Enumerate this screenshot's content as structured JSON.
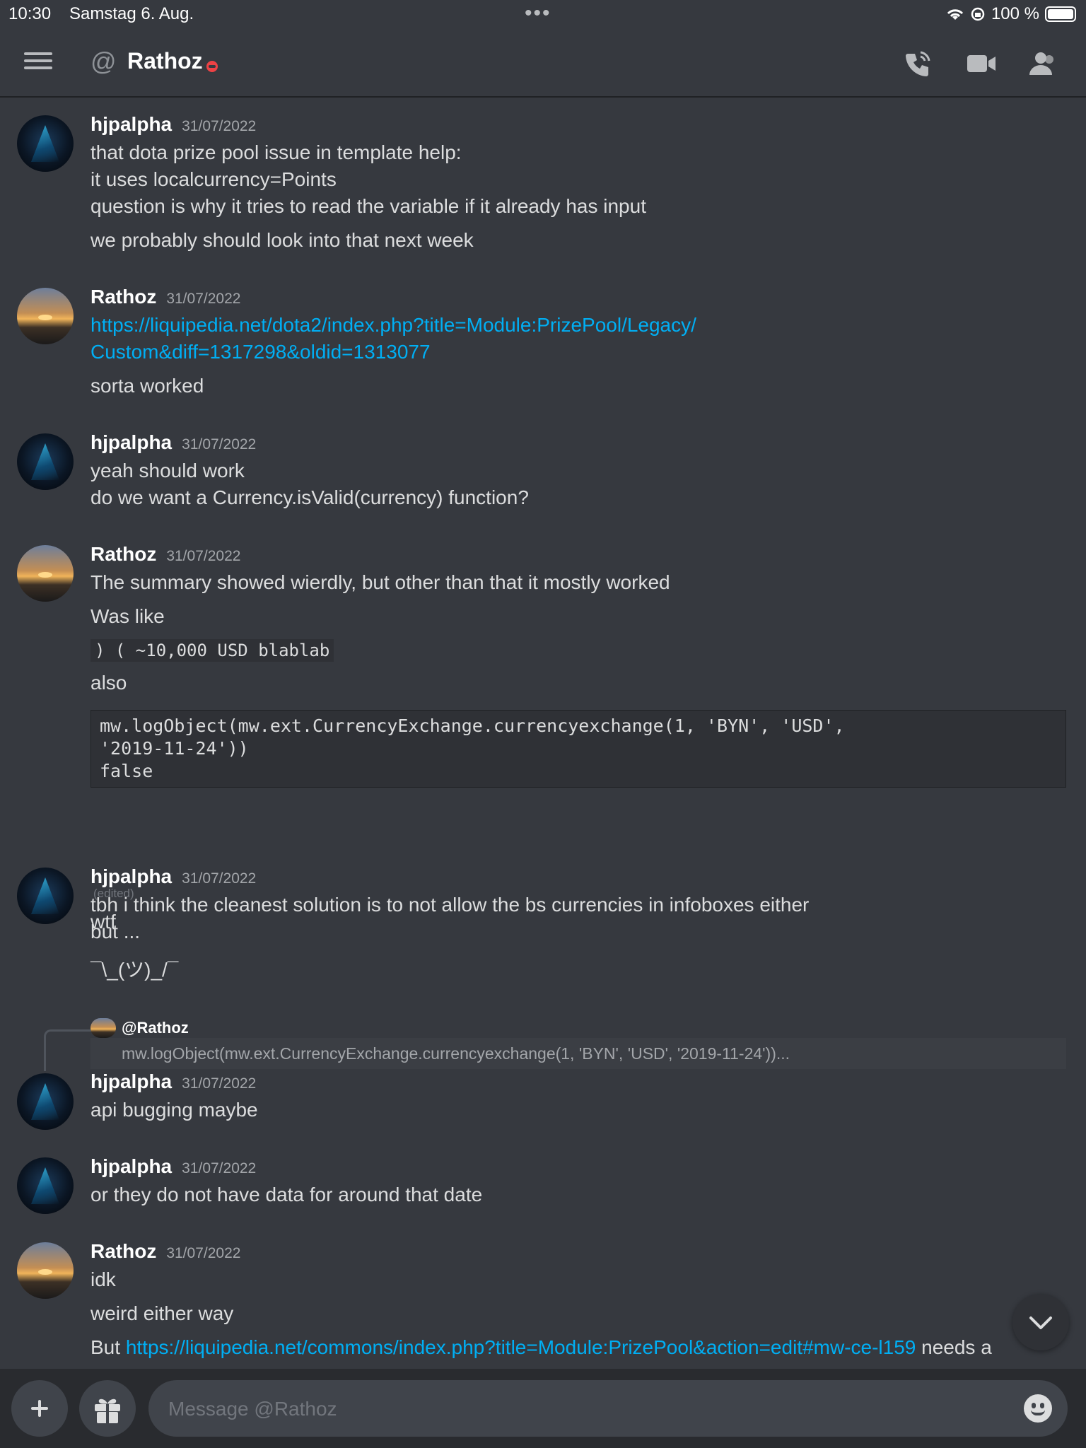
{
  "status_bar": {
    "time": "10:30",
    "date": "Samstag 6. Aug.",
    "battery": "100 %"
  },
  "header": {
    "title": "Rathoz",
    "status": "do-not-disturb"
  },
  "messages": [
    {
      "author": "hjpalpha",
      "timestamp": "31/07/2022",
      "avatar": "hjpalpha",
      "lines": [
        "that dota prize pool issue in template help:",
        "it uses localcurrency=Points",
        "question is why it tries to read the variable if it already has input",
        "we probably should look into that next week"
      ]
    },
    {
      "author": "Rathoz",
      "timestamp": "31/07/2022",
      "avatar": "rathoz",
      "link1": "https://liquipedia.net/dota2/index.php?title=Module:PrizePool/Legacy/",
      "link2": "Custom&diff=1317298&oldid=1313077",
      "lines": [
        "sorta worked"
      ]
    },
    {
      "author": "hjpalpha",
      "timestamp": "31/07/2022",
      "avatar": "hjpalpha",
      "lines": [
        "yeah should work",
        "do we want a Currency.isValid(currency) function?"
      ]
    },
    {
      "author": "Rathoz",
      "timestamp": "31/07/2022",
      "avatar": "rathoz",
      "lines": [
        "The summary showed wierdly, but other than that it mostly worked",
        "Was like"
      ],
      "inline_code": ") ( ~10,000 USD blablab",
      "line_also": "also",
      "code_block": [
        "mw.logObject(mw.ext.CurrencyExchange.currencyexchange(1, 'BYN', 'USD',",
        "'2019-11-24'))",
        "false"
      ],
      "edited": "(edited)",
      "line_after": "wtf"
    },
    {
      "author": "hjpalpha",
      "timestamp": "31/07/2022",
      "avatar": "hjpalpha",
      "lines": [
        "tbh i think the cleanest solution is to not allow the bs currencies in infoboxes either",
        "but ...",
        "¯\\_(ツ)_/¯"
      ]
    },
    {
      "reply_to": "@Rathoz",
      "reply_preview": "mw.logObject(mw.ext.CurrencyExchange.currencyexchange(1, 'BYN', 'USD', '2019-11-24'))...",
      "author": "hjpalpha",
      "timestamp": "31/07/2022",
      "avatar": "hjpalpha",
      "lines": [
        "api bugging maybe"
      ]
    },
    {
      "author": "hjpalpha",
      "timestamp": "31/07/2022",
      "avatar": "hjpalpha",
      "lines": [
        "or they do not have data for around that date"
      ]
    },
    {
      "author": "Rathoz",
      "timestamp": "31/07/2022",
      "avatar": "rathoz",
      "lines": [
        "idk",
        "weird either way"
      ],
      "last_prefix": "But ",
      "last_link": "https://liquipedia.net/commons/index.php?title=Module:PrizePool&action=edit#mw-ce-l159",
      "last_suffix": " needs a"
    }
  ],
  "composer": {
    "placeholder": "Message @Rathoz"
  }
}
